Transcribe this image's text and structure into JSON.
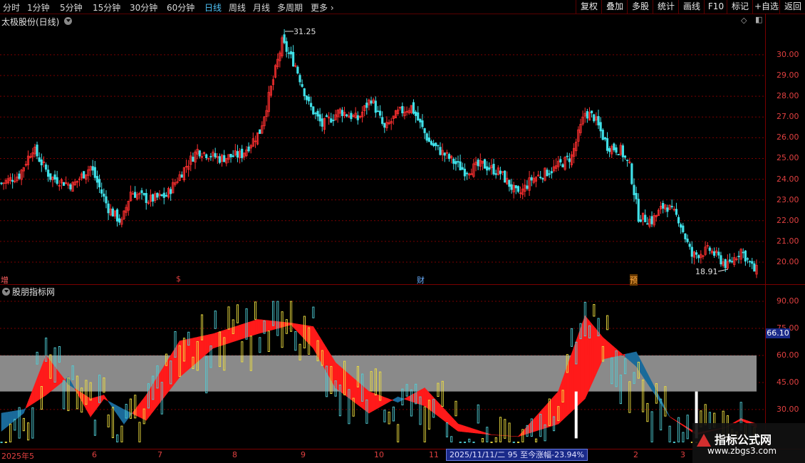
{
  "toolbar": {
    "timeframes": [
      "分时",
      "1分钟",
      "5分钟",
      "15分钟",
      "30分钟",
      "60分钟",
      "日线",
      "周线",
      "月线",
      "多周期",
      "更多"
    ],
    "active_timeframe": "日线",
    "right_buttons": [
      "复权",
      "叠加",
      "多股",
      "统计",
      "画线",
      "F10",
      "标记",
      "+自选",
      "返回"
    ]
  },
  "main_panel": {
    "title": "太极股份(日线)",
    "high_label": "31.25",
    "low_label": "18.91",
    "markers": [
      {
        "text": "增",
        "color": "#ff6060"
      },
      {
        "text": "$",
        "color": "#e04040"
      },
      {
        "text": "财",
        "color": "#6aaeff"
      },
      {
        "text": "预",
        "color": "#ffaa44"
      }
    ]
  },
  "indicator_panel": {
    "title": "股朋指标网",
    "current_value": "66.10"
  },
  "axis": {
    "price_ticks": [
      "30.00",
      "29.00",
      "28.00",
      "27.00",
      "26.00",
      "25.00",
      "24.00",
      "23.00",
      "22.00",
      "21.00",
      "20.00"
    ],
    "indicator_ticks": [
      "90.00",
      "75.00",
      "60.00",
      "45.00",
      "30.00"
    ],
    "date_ticks": [
      "2025年5",
      "6",
      "7",
      "8",
      "9",
      "10",
      "11",
      "2",
      "3"
    ]
  },
  "status": {
    "text": "2025/11/11/二 95 至今涨幅-23.94%"
  },
  "watermark": {
    "line1": "指标公式网",
    "line2": "www.zbgs3.com"
  },
  "chart_data": [
    {
      "type": "candlestick",
      "title": "太极股份(日线)",
      "ylim": [
        19.3,
        31.6
      ],
      "y_ticks": [
        20,
        21,
        22,
        23,
        24,
        25,
        26,
        27,
        28,
        29,
        30
      ],
      "x_ticks": [
        "2025年5",
        "6",
        "7",
        "8",
        "9",
        "10",
        "11",
        "2",
        "3"
      ],
      "annotations": [
        {
          "label": "31.25",
          "type": "high"
        },
        {
          "label": "18.91",
          "type": "low"
        }
      ],
      "close_trend": [
        {
          "i": 0,
          "v": 23.8
        },
        {
          "i": 8,
          "v": 24.2
        },
        {
          "i": 14,
          "v": 25.5
        },
        {
          "i": 22,
          "v": 24.1
        },
        {
          "i": 32,
          "v": 23.7
        },
        {
          "i": 40,
          "v": 24.6
        },
        {
          "i": 48,
          "v": 22.6
        },
        {
          "i": 54,
          "v": 21.9
        },
        {
          "i": 58,
          "v": 23.4
        },
        {
          "i": 66,
          "v": 23.0
        },
        {
          "i": 74,
          "v": 23.2
        },
        {
          "i": 82,
          "v": 24.5
        },
        {
          "i": 88,
          "v": 25.4
        },
        {
          "i": 98,
          "v": 25.0
        },
        {
          "i": 108,
          "v": 25.2
        },
        {
          "i": 116,
          "v": 26.3
        },
        {
          "i": 122,
          "v": 28.8
        },
        {
          "i": 126,
          "v": 30.6
        },
        {
          "i": 132,
          "v": 29.5
        },
        {
          "i": 138,
          "v": 27.6
        },
        {
          "i": 144,
          "v": 26.6
        },
        {
          "i": 152,
          "v": 27.3
        },
        {
          "i": 160,
          "v": 26.9
        },
        {
          "i": 166,
          "v": 27.9
        },
        {
          "i": 172,
          "v": 26.4
        },
        {
          "i": 178,
          "v": 27.2
        },
        {
          "i": 184,
          "v": 27.5
        },
        {
          "i": 192,
          "v": 25.8
        },
        {
          "i": 200,
          "v": 25.1
        },
        {
          "i": 208,
          "v": 24.4
        },
        {
          "i": 216,
          "v": 24.7
        },
        {
          "i": 224,
          "v": 24.3
        },
        {
          "i": 232,
          "v": 23.2
        },
        {
          "i": 238,
          "v": 24.0
        },
        {
          "i": 248,
          "v": 24.5
        },
        {
          "i": 256,
          "v": 25.1
        },
        {
          "i": 262,
          "v": 27.2
        },
        {
          "i": 266,
          "v": 27.0
        },
        {
          "i": 272,
          "v": 25.6
        },
        {
          "i": 278,
          "v": 25.4
        },
        {
          "i": 282,
          "v": 24.6
        },
        {
          "i": 286,
          "v": 22.2
        },
        {
          "i": 292,
          "v": 22.0
        },
        {
          "i": 298,
          "v": 22.8
        },
        {
          "i": 304,
          "v": 22.1
        },
        {
          "i": 310,
          "v": 20.3
        },
        {
          "i": 318,
          "v": 20.6
        },
        {
          "i": 326,
          "v": 19.8
        },
        {
          "i": 332,
          "v": 20.6
        },
        {
          "i": 338,
          "v": 19.6
        }
      ],
      "bar_count": 340
    },
    {
      "type": "area",
      "title": "股朋指标网",
      "ylim": [
        11,
        92
      ],
      "y_ticks": [
        30,
        45,
        60,
        75,
        90
      ],
      "band": [
        40,
        60
      ],
      "current": 66.1,
      "line_a": [
        {
          "i": 0,
          "v": 18
        },
        {
          "i": 10,
          "v": 28
        },
        {
          "i": 20,
          "v": 60
        },
        {
          "i": 30,
          "v": 44
        },
        {
          "i": 40,
          "v": 36
        },
        {
          "i": 46,
          "v": 38
        },
        {
          "i": 55,
          "v": 22
        },
        {
          "i": 65,
          "v": 38
        },
        {
          "i": 80,
          "v": 68
        },
        {
          "i": 95,
          "v": 72
        },
        {
          "i": 115,
          "v": 80
        },
        {
          "i": 130,
          "v": 78
        },
        {
          "i": 140,
          "v": 76
        },
        {
          "i": 150,
          "v": 56
        },
        {
          "i": 165,
          "v": 40
        },
        {
          "i": 178,
          "v": 34
        },
        {
          "i": 190,
          "v": 42
        },
        {
          "i": 205,
          "v": 22
        },
        {
          "i": 220,
          "v": 16
        },
        {
          "i": 232,
          "v": 15
        },
        {
          "i": 250,
          "v": 40
        },
        {
          "i": 262,
          "v": 82
        },
        {
          "i": 270,
          "v": 70
        },
        {
          "i": 285,
          "v": 54
        },
        {
          "i": 300,
          "v": 26
        },
        {
          "i": 312,
          "v": 17
        },
        {
          "i": 325,
          "v": 20
        },
        {
          "i": 332,
          "v": 25
        },
        {
          "i": 339,
          "v": 22
        }
      ],
      "line_b": [
        {
          "i": 0,
          "v": 28
        },
        {
          "i": 10,
          "v": 30
        },
        {
          "i": 20,
          "v": 38
        },
        {
          "i": 30,
          "v": 48
        },
        {
          "i": 40,
          "v": 26
        },
        {
          "i": 46,
          "v": 36
        },
        {
          "i": 55,
          "v": 30
        },
        {
          "i": 65,
          "v": 24
        },
        {
          "i": 80,
          "v": 48
        },
        {
          "i": 95,
          "v": 64
        },
        {
          "i": 115,
          "v": 72
        },
        {
          "i": 130,
          "v": 77
        },
        {
          "i": 140,
          "v": 64
        },
        {
          "i": 150,
          "v": 42
        },
        {
          "i": 165,
          "v": 28
        },
        {
          "i": 178,
          "v": 37
        },
        {
          "i": 190,
          "v": 32
        },
        {
          "i": 205,
          "v": 18
        },
        {
          "i": 220,
          "v": 16
        },
        {
          "i": 232,
          "v": 15
        },
        {
          "i": 250,
          "v": 22
        },
        {
          "i": 262,
          "v": 36
        },
        {
          "i": 270,
          "v": 58
        },
        {
          "i": 285,
          "v": 62
        },
        {
          "i": 300,
          "v": 26
        },
        {
          "i": 312,
          "v": 16
        },
        {
          "i": 325,
          "v": 20
        },
        {
          "i": 332,
          "v": 24
        },
        {
          "i": 339,
          "v": 20
        }
      ]
    }
  ],
  "colors": {
    "up": "#ff3030",
    "down": "#40e0e8",
    "band": "#8a8a8a",
    "area_up": "#ff1a1a",
    "area_down": "#1a6a9a",
    "grid": "#7a0000"
  }
}
